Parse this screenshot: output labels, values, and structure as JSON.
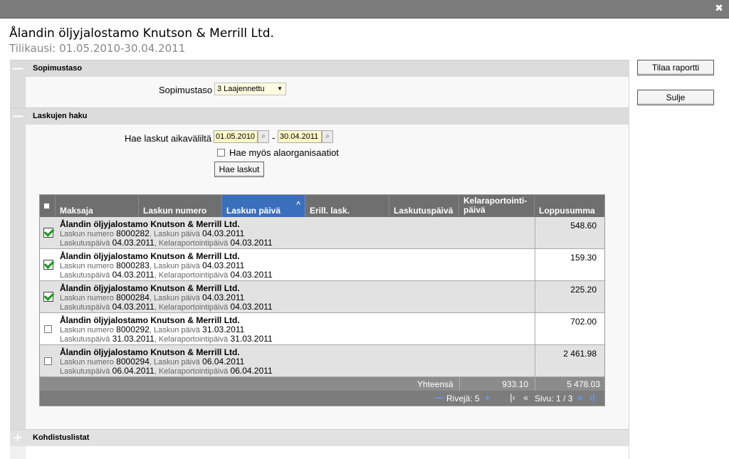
{
  "window": {
    "close_symbol": "✖"
  },
  "header": {
    "title": "Ålandin öljyjalostamo Knutson & Merrill Ltd.",
    "subtitle": "Tilikausi: 01.05.2010-30.04.2011"
  },
  "side_buttons": {
    "order_report": "Tilaa raportti",
    "close": "Sulje"
  },
  "sections": {
    "agreement": {
      "toggle": "—",
      "title": "Sopimustaso",
      "label": "Sopimustaso",
      "selected": "3 Laajennettu"
    },
    "search": {
      "toggle": "—",
      "title": "Laskujen haku",
      "range_label": "Hae laskut aikaväliltä",
      "date_from": "01.05.2010",
      "date_to": "30.04.2011",
      "dash": "-",
      "include_sub_label": "Hae myös alaorganisaatiot",
      "search_button": "Hae laskut"
    },
    "allocation": {
      "toggle": "+",
      "title": "Kohdistuslistat"
    }
  },
  "grid": {
    "columns": [
      "Maksaja",
      "Laskun numero",
      "Laskun päivä",
      "Erill. lask.",
      "Laskutuspäivä",
      "Kelaraportointi-päivä",
      "Loppusumma"
    ],
    "column_kela_line1": "Kelaraportointi-",
    "column_kela_line2": "päivä",
    "sort_symbol": "^",
    "field_labels": {
      "invoice_number": "Laskun numero",
      "invoice_date": ", Laskun päivä",
      "billing_date": "Laskutuspäivä",
      "kela_date": ", Kelaraportointipäivä"
    },
    "rows": [
      {
        "payer": "Ålandin öljyjalostamo Knutson & Merrill Ltd.",
        "number": "8000282",
        "date": "04.03.2011",
        "billing": "04.03.2011",
        "kela": "04.03.2011",
        "amount": "548.60",
        "checked": true
      },
      {
        "payer": "Ålandin öljyjalostamo Knutson & Merrill Ltd.",
        "number": "8000283",
        "date": "04.03.2011",
        "billing": "04.03.2011",
        "kela": "04.03.2011",
        "amount": "159.30",
        "checked": true
      },
      {
        "payer": "Ålandin öljyjalostamo Knutson & Merrill Ltd.",
        "number": "8000284",
        "date": "04.03.2011",
        "billing": "04.03.2011",
        "kela": "04.03.2011",
        "amount": "225.20",
        "checked": true
      },
      {
        "payer": "Ålandin öljyjalostamo Knutson & Merrill Ltd.",
        "number": "8000292",
        "date": "31.03.2011",
        "billing": "31.03.2011",
        "kela": "31.03.2011",
        "amount": "702.00",
        "checked": false
      },
      {
        "payer": "Ålandin öljyjalostamo Knutson & Merrill Ltd.",
        "number": "8000294",
        "date": "06.04.2011",
        "billing": "06.04.2011",
        "kela": "06.04.2011",
        "amount": "2 461.98",
        "checked": false
      }
    ],
    "totals": {
      "label": "Yhteensä",
      "selected_total": "933.10",
      "grand_total": "5 478.03"
    },
    "pager": {
      "rows_label": "Rivejä: 5",
      "page_label": "Sivu: 1 / 3",
      "minus": "—",
      "plus": "+",
      "first": "|‹",
      "prev": "«",
      "next": "»",
      "last": "›|"
    }
  }
}
